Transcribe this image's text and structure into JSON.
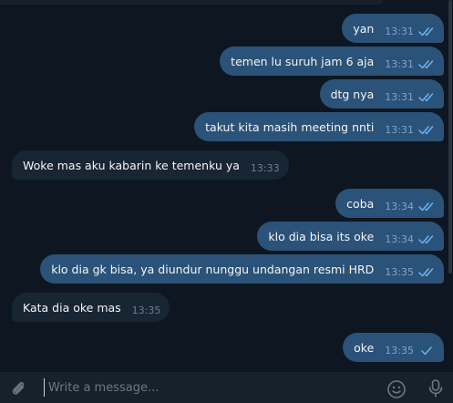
{
  "messages": [
    {
      "dir": "out",
      "text": "yan",
      "time": "13:31",
      "read": true
    },
    {
      "dir": "out",
      "text": "temen lu suruh jam 6 aja",
      "time": "13:31",
      "read": true
    },
    {
      "dir": "out",
      "text": "dtg nya",
      "time": "13:31",
      "read": true
    },
    {
      "dir": "out",
      "text": "takut kita masih meeting nnti",
      "time": "13:31",
      "read": true
    },
    {
      "dir": "in",
      "text": "Woke mas aku kabarin ke temenku ya",
      "time": "13:33"
    },
    {
      "dir": "out",
      "text": "coba",
      "time": "13:34",
      "read": true
    },
    {
      "dir": "out",
      "text": "klo dia bisa its oke",
      "time": "13:34",
      "read": true
    },
    {
      "dir": "out",
      "text": "klo dia gk bisa, ya diundur nunggu undangan resmi HRD",
      "time": "13:35",
      "read": true
    },
    {
      "dir": "in",
      "text": "Kata dia oke mas",
      "time": "13:35"
    },
    {
      "dir": "out",
      "text": "oke",
      "time": "13:35",
      "read": false
    }
  ],
  "composer": {
    "placeholder": "Write a message...",
    "attach_icon": "paperclip-icon",
    "emoji_icon": "emoji-icon",
    "mic_icon": "microphone-icon"
  },
  "colors": {
    "background": "#0e1621",
    "outgoing_bubble": "#2b5278",
    "incoming_bubble": "#182533",
    "tick": "#6ab3f3",
    "composer": "#17212b"
  }
}
